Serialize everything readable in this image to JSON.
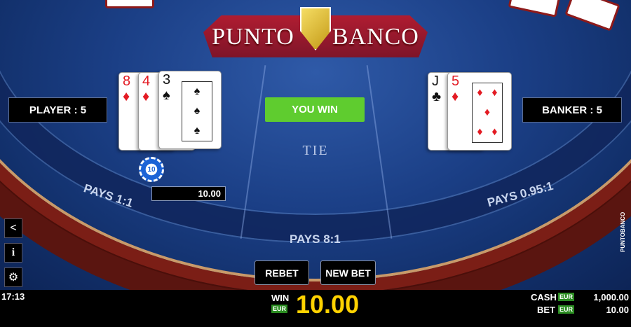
{
  "logo": {
    "left_word": "PUNTO",
    "right_word": "BANCO"
  },
  "player": {
    "label": "PLAYER : 5",
    "pays": "PAYS 1:1",
    "cards": [
      {
        "rank": "8",
        "suit": "♦",
        "color": "red"
      },
      {
        "rank": "4",
        "suit": "♦",
        "color": "red"
      },
      {
        "rank": "3",
        "suit": "♠",
        "color": "black"
      }
    ]
  },
  "banker": {
    "label": "BANKER : 5",
    "pays": "PAYS 0.95:1",
    "cards": [
      {
        "rank": "J",
        "suit": "♣",
        "color": "black"
      },
      {
        "rank": "5",
        "suit": "♦",
        "color": "red"
      }
    ]
  },
  "result": {
    "banner": "YOU WIN",
    "banner_color": "#5fcc2f"
  },
  "tie": {
    "label": "TIE",
    "pays": "PAYS 8:1"
  },
  "bet": {
    "chip_value": "10",
    "amount": "10.00"
  },
  "buttons": {
    "rebet": "REBET",
    "new_bet": "NEW BET"
  },
  "side_icons": [
    "share-icon",
    "info-icon",
    "gear-icon"
  ],
  "side_label": "PUNTOBANCO",
  "status": {
    "time": "17:13",
    "win_label": "WIN",
    "currency": "EUR",
    "win_value": "10.00",
    "cash_label": "CASH",
    "cash_value": "1,000.00",
    "bet_label": "BET",
    "bet_value": "10.00"
  },
  "colors": {
    "table_blue": "#1b3f86",
    "rim_red": "#7b1e16",
    "win_yellow": "#ffd200",
    "eur_green": "#2b8d22"
  }
}
